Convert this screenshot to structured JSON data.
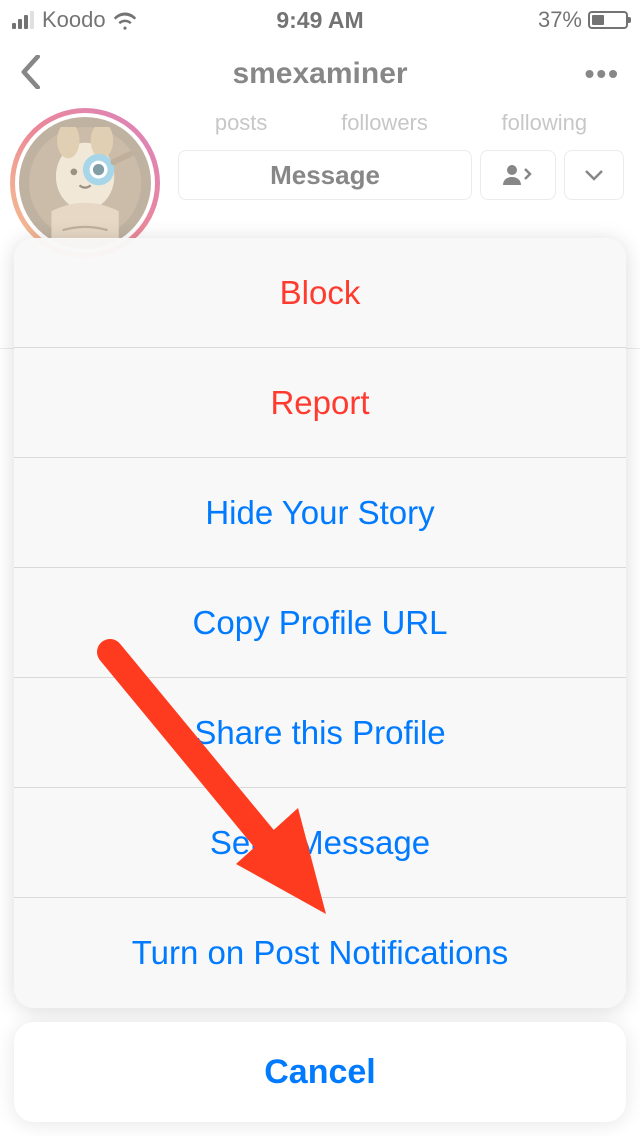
{
  "status": {
    "carrier": "Koodo",
    "time": "9:49 AM",
    "battery_pct": "37%",
    "battery_fill": 37
  },
  "nav": {
    "title": "smexaminer"
  },
  "profile": {
    "stats": {
      "posts": "posts",
      "followers": "followers",
      "following": "following"
    },
    "buttons": {
      "message": "Message"
    }
  },
  "actionsheet": {
    "items": [
      {
        "label": "Block",
        "style": "destructive"
      },
      {
        "label": "Report",
        "style": "destructive"
      },
      {
        "label": "Hide Your Story",
        "style": "normal"
      },
      {
        "label": "Copy Profile URL",
        "style": "normal"
      },
      {
        "label": "Share this Profile",
        "style": "normal"
      },
      {
        "label": "Send Message",
        "style": "normal"
      },
      {
        "label": "Turn on Post Notifications",
        "style": "normal"
      }
    ],
    "cancel": "Cancel"
  }
}
